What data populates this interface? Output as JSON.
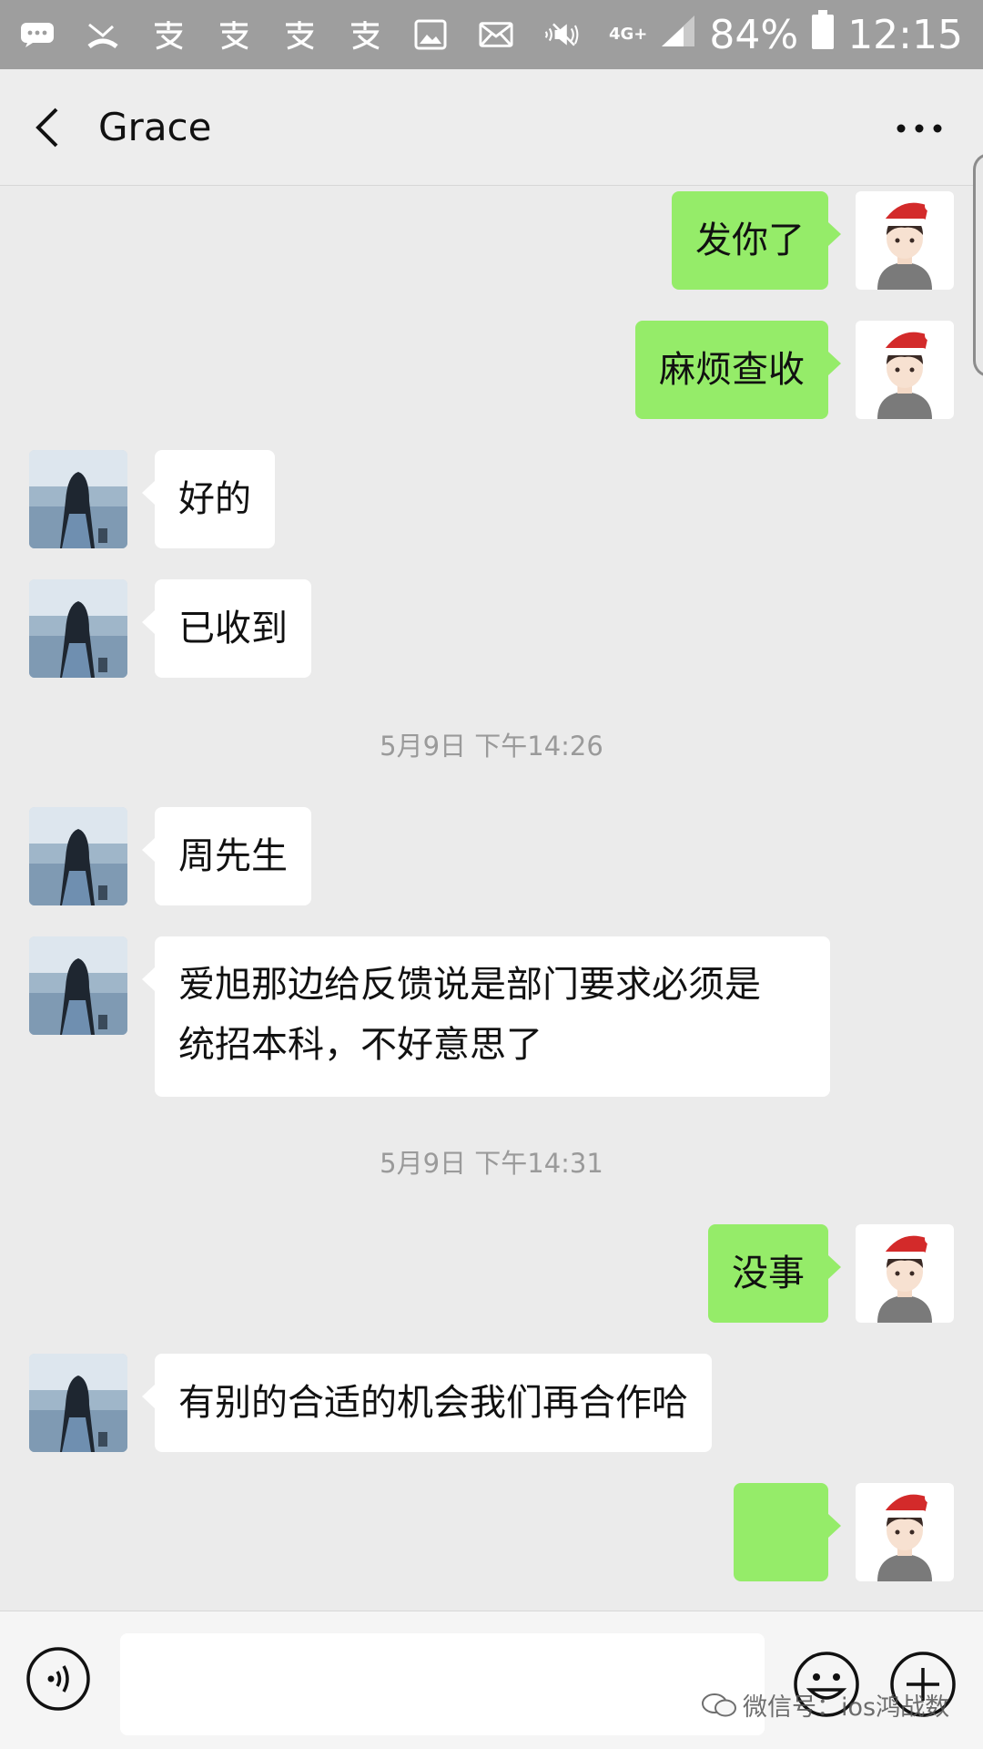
{
  "status_bar": {
    "network": "4G+",
    "battery": "84%",
    "time": "12:15"
  },
  "header": {
    "title": "Grace"
  },
  "messages": [
    {
      "side": "out",
      "text": "发你了"
    },
    {
      "side": "out",
      "text": "麻烦查收"
    },
    {
      "side": "in",
      "text": "好的"
    },
    {
      "side": "in",
      "text": "已收到"
    },
    {
      "timestamp": "5月9日 下午14:26"
    },
    {
      "side": "in",
      "text": "周先生"
    },
    {
      "side": "in",
      "text": "爱旭那边给反馈说是部门要求必须是\n统招本科，不好意思了"
    },
    {
      "timestamp": "5月9日 下午14:31"
    },
    {
      "side": "out",
      "text": "没事"
    },
    {
      "side": "in",
      "text": "有别的合适的机会我们再合作哈"
    },
    {
      "side": "out",
      "text": "👌",
      "is_emoji": true
    }
  ],
  "input": {
    "value": ""
  },
  "watermark": {
    "text": "微信号：ios鸿战数"
  },
  "icons": {
    "back": "chevron-left-icon",
    "more": "more-dots-icon",
    "voice": "voice-icon",
    "emoji": "emoji-icon",
    "plus": "plus-icon"
  },
  "colors": {
    "sent_bubble": "#95ec69",
    "received_bubble": "#ffffff",
    "background": "#ebebeb",
    "status_bar": "#9e9e9e"
  }
}
